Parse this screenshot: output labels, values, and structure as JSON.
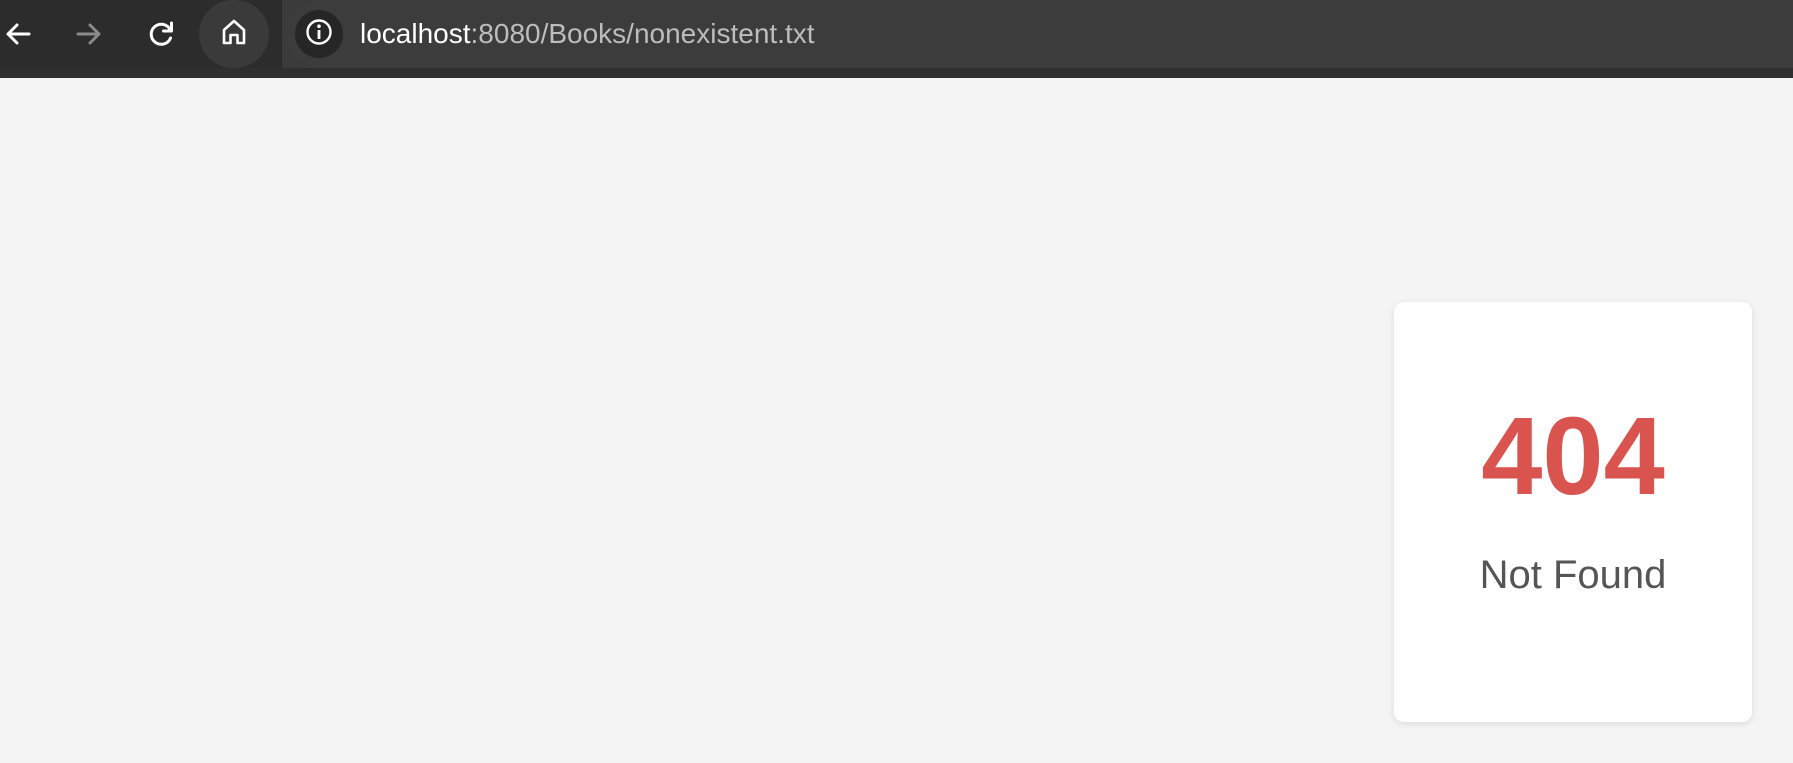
{
  "browser": {
    "url_host": "localhost",
    "url_path": ":8080/Books/nonexistent.txt",
    "icons": {
      "back": "arrow-left-icon",
      "forward": "arrow-right-icon",
      "reload": "reload-icon",
      "home": "home-icon",
      "site_info": "info-icon"
    }
  },
  "error": {
    "code": "404",
    "message": "Not Found",
    "code_color": "#d9534f",
    "message_color": "#555555"
  }
}
